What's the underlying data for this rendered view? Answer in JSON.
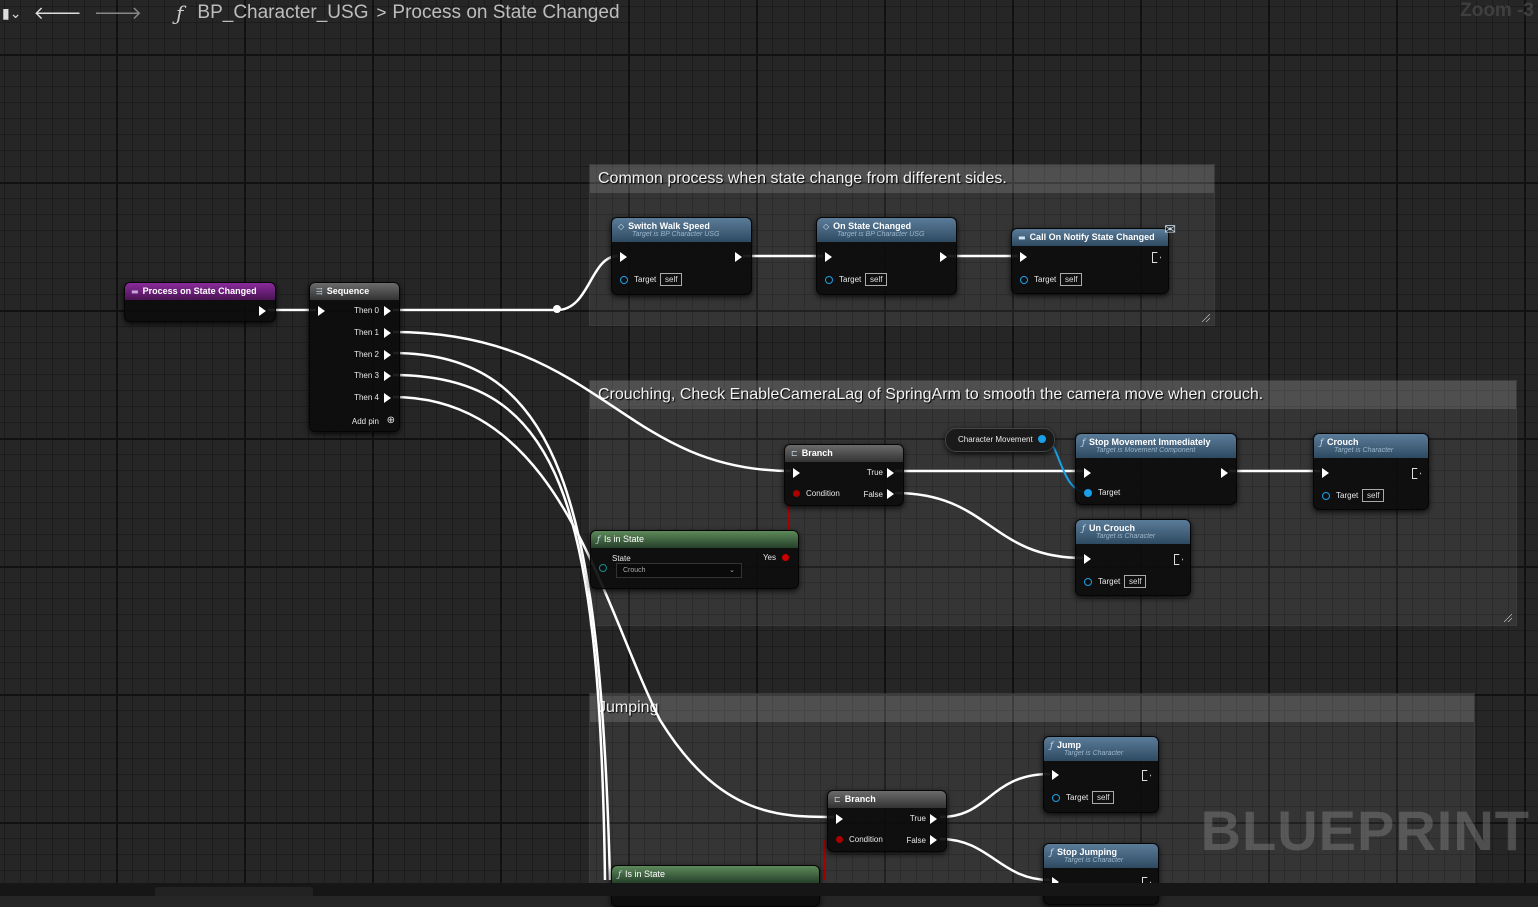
{
  "topbar": {
    "back_icon": "arrow-left-icon",
    "forward_icon": "arrow-right-icon",
    "function_icon": "function-icon",
    "breadcrumb": [
      "BP_Character_USG",
      "Process on State Changed"
    ],
    "separator": ">",
    "zoom_label": "Zoom -3"
  },
  "watermark": "BLUEPRINT",
  "comments": [
    {
      "title": "Common process when state change from different sides."
    },
    {
      "title": "Crouching, Check EnableCameraLag of SpringArm to smooth the camera move when crouch."
    },
    {
      "title": "Jumping"
    }
  ],
  "nodes": {
    "entry": {
      "title": "Process on State Changed",
      "icon": "function-entry-icon"
    },
    "sequence": {
      "title": "Sequence",
      "pins": [
        "Then 0",
        "Then 1",
        "Then 2",
        "Then 3",
        "Then 4"
      ],
      "add_pin": "Add pin"
    },
    "switch_walk_speed": {
      "title": "Switch Walk Speed",
      "subtitle": "Target is BP Character USG",
      "target_label": "Target",
      "target_value": "self"
    },
    "on_state_changed": {
      "title": "On State Changed",
      "subtitle": "Target is BP Character USG",
      "target_label": "Target",
      "target_value": "self"
    },
    "call_notify": {
      "title": "Call On Notify State Changed",
      "target_label": "Target",
      "target_value": "self"
    },
    "branch1": {
      "title": "Branch",
      "condition": "Condition",
      "true": "True",
      "false": "False"
    },
    "char_movement": {
      "title": "Character Movement"
    },
    "stop_movement": {
      "title": "Stop Movement Immediately",
      "subtitle": "Target is Movement Component",
      "target_label": "Target"
    },
    "crouch": {
      "title": "Crouch",
      "subtitle": "Target is Character",
      "target_label": "Target",
      "target_value": "self"
    },
    "uncrouch": {
      "title": "Un Crouch",
      "subtitle": "Target is Character",
      "target_label": "Target",
      "target_value": "self"
    },
    "is_in_state1": {
      "title": "Is in State",
      "state_label": "State",
      "state_value": "Crouch",
      "yes": "Yes"
    },
    "branch2": {
      "title": "Branch",
      "condition": "Condition",
      "true": "True",
      "false": "False"
    },
    "jump": {
      "title": "Jump",
      "subtitle": "Target is Character",
      "target_label": "Target",
      "target_value": "self"
    },
    "stop_jumping": {
      "title": "Stop Jumping",
      "subtitle": "Target is Character"
    },
    "is_in_state2": {
      "title": "Is in State"
    }
  }
}
